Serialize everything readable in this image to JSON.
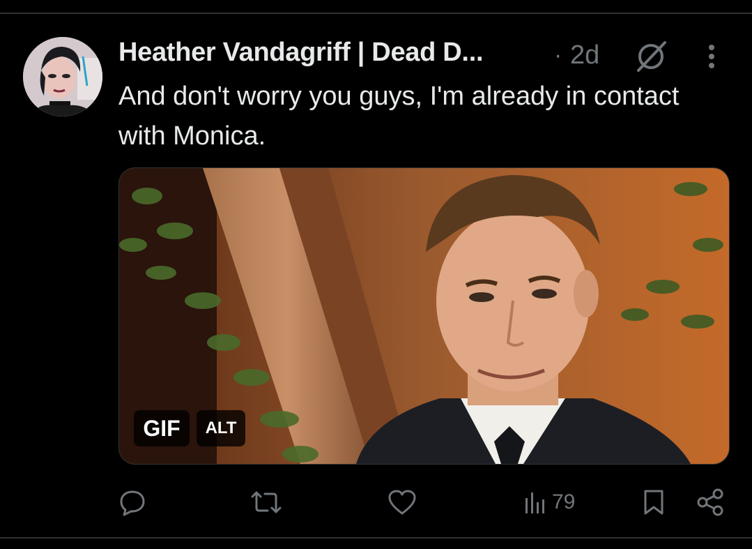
{
  "tweet": {
    "author_name": "Heather Vandagriff | Dead D...",
    "separator": "·",
    "timestamp": "2d",
    "text": "And don't worry you guys, I'm already in contact with Monica."
  },
  "media": {
    "gif_badge": "GIF",
    "alt_badge": "ALT"
  },
  "actions": {
    "views_count": "79"
  },
  "icons": {
    "grok": "grok-icon",
    "more": "more-vertical-icon",
    "reply": "reply-icon",
    "retweet": "retweet-icon",
    "like": "heart-icon",
    "views": "views-chart-icon",
    "bookmark": "bookmark-icon",
    "share": "share-icon"
  },
  "colors": {
    "background": "#000000",
    "text_primary": "#e7e9ea",
    "text_secondary": "#71767b",
    "divider": "#2f3336"
  }
}
